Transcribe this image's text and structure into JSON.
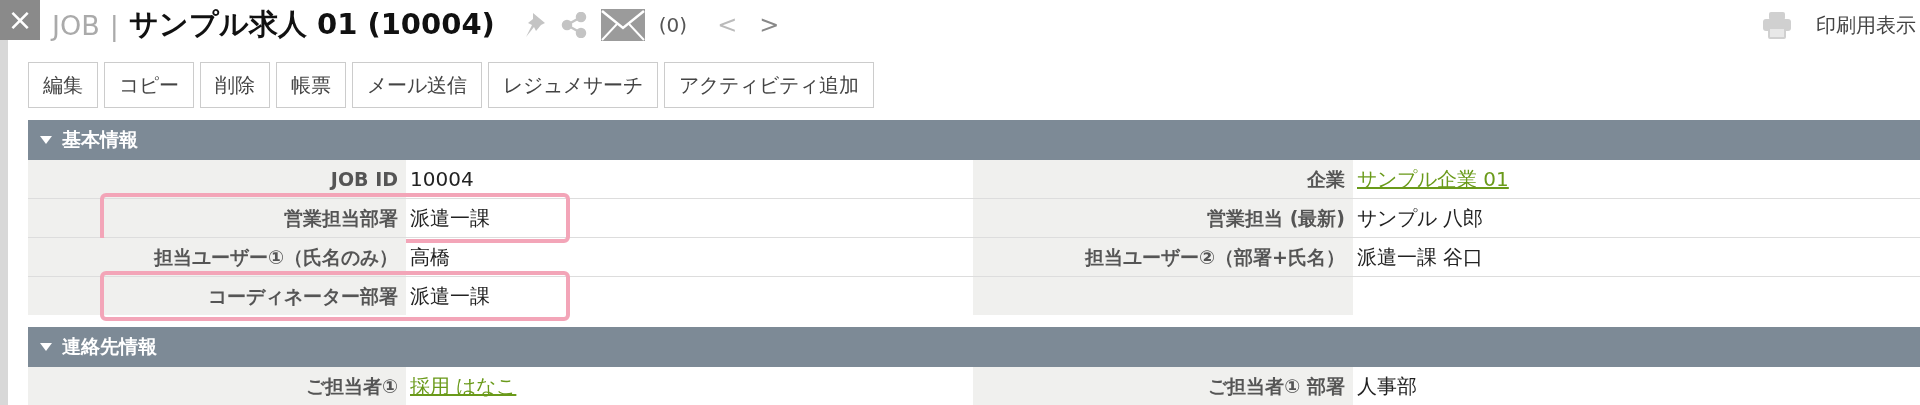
{
  "close_button": "×",
  "title": {
    "prefix": "JOB",
    "separator": "|",
    "name": "サンプル求人 01 (10004)"
  },
  "mail_count": "(0)",
  "nav": [
    "<",
    ">"
  ],
  "print_label": "印刷用表示",
  "toolbar": [
    "編集",
    "コピー",
    "削除",
    "帳票",
    "メール送信",
    "レジュメサーチ",
    "アクティビティ追加"
  ],
  "sections": [
    {
      "title": "基本情報",
      "expanded": true,
      "rows": [
        {
          "left": {
            "label": "JOB ID",
            "value": "10004",
            "kind": "text",
            "highlighted": false
          },
          "right": {
            "label": "企業",
            "value": "サンプル企業 01",
            "kind": "link"
          }
        },
        {
          "left": {
            "label": "営業担当部署",
            "value": "派遣一課",
            "kind": "text",
            "highlighted": true
          },
          "right": {
            "label": "営業担当 (最新)",
            "value": "サンプル 八郎",
            "kind": "text"
          }
        },
        {
          "left": {
            "label": "担当ユーザー①（氏名のみ）",
            "value": "高橋",
            "kind": "text",
            "highlighted": false
          },
          "right": {
            "label": "担当ユーザー②（部署+氏名）",
            "value": "派遣一課 谷口",
            "kind": "text"
          }
        },
        {
          "left": {
            "label": "コーディネーター部署",
            "value": "派遣一課",
            "kind": "text",
            "highlighted": true
          }
        }
      ]
    },
    {
      "title": "連絡先情報",
      "expanded": true,
      "rows": [
        {
          "left": {
            "label": "ご担当者①",
            "value": "採用 はなこ",
            "kind": "link",
            "highlighted": false
          },
          "right": {
            "label": "ご担当者① 部署",
            "value": "人事部",
            "kind": "text"
          }
        }
      ]
    }
  ]
}
